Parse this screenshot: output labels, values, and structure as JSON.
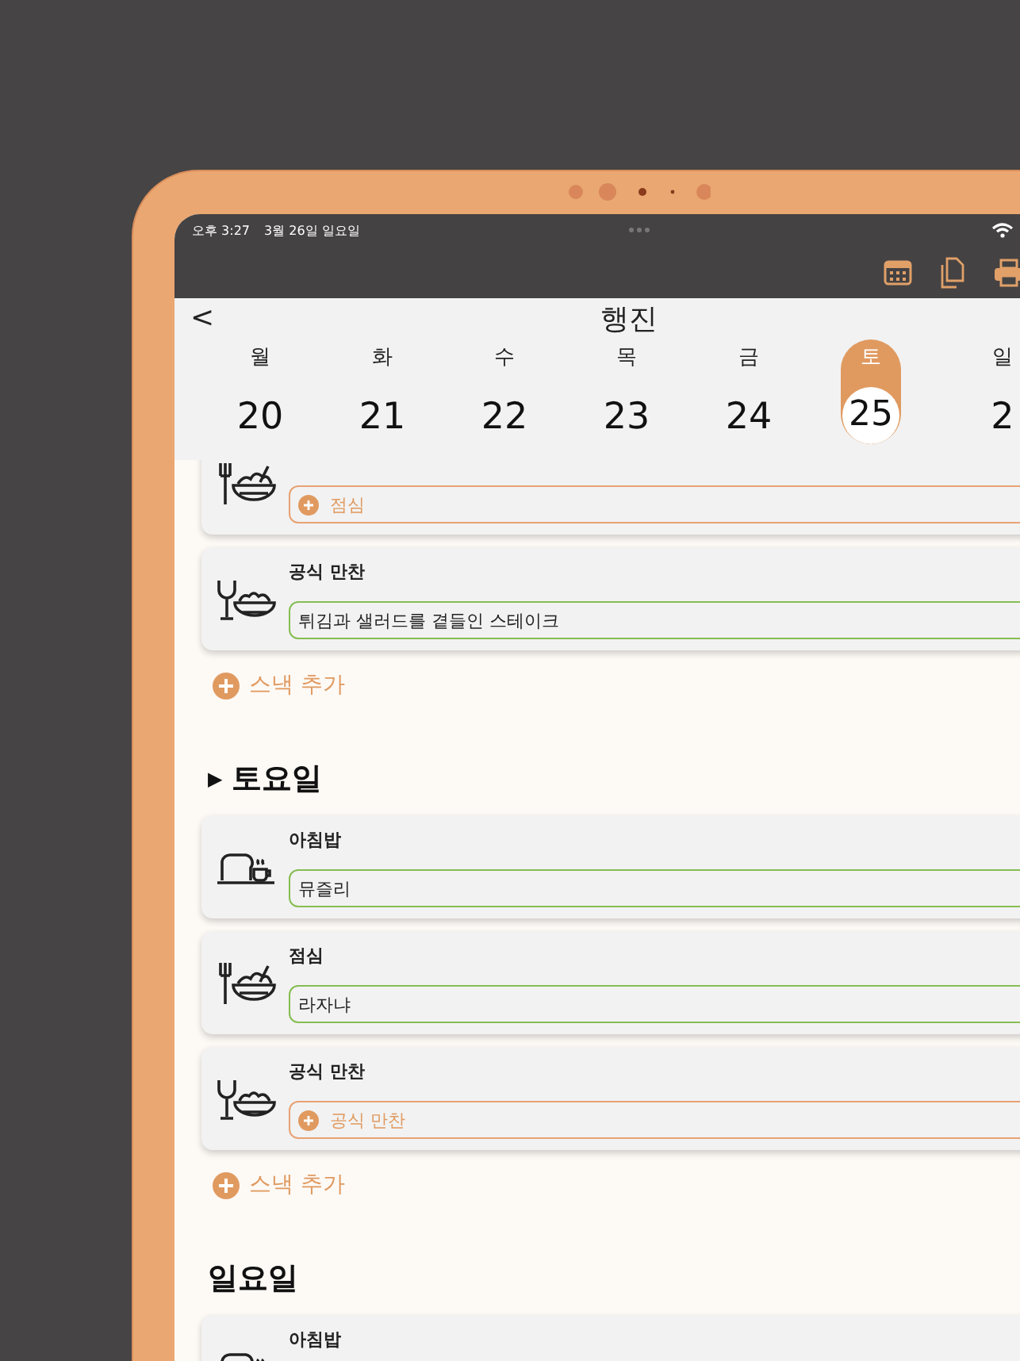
{
  "status_bar": {
    "time": "오후 3:27",
    "date": "3월 26일 일요일"
  },
  "header": {
    "back": "<",
    "title": "행진"
  },
  "week": [
    {
      "weekday": "월",
      "date": "20",
      "selected": false
    },
    {
      "weekday": "화",
      "date": "21",
      "selected": false
    },
    {
      "weekday": "수",
      "date": "22",
      "selected": false
    },
    {
      "weekday": "목",
      "date": "23",
      "selected": false
    },
    {
      "weekday": "금",
      "date": "24",
      "selected": false
    },
    {
      "weekday": "토",
      "date": "25",
      "selected": true
    },
    {
      "weekday": "일",
      "date": "2",
      "selected": false
    }
  ],
  "sections": [
    {
      "meals": [
        {
          "kind": "lunch",
          "placeholder": "점심"
        },
        {
          "kind": "dinner",
          "label": "공식 만찬",
          "value": "튀김과 샐러드를 곁들인 스테이크"
        }
      ],
      "add_snack": "스낵 추가"
    },
    {
      "marker": "▶",
      "title": "토요일",
      "meals": [
        {
          "kind": "breakfast",
          "label": "아침밥",
          "value": "뮤즐리"
        },
        {
          "kind": "lunch",
          "label": "점심",
          "value": "라자냐"
        },
        {
          "kind": "dinner",
          "label": "공식 만찬",
          "placeholder": "공식 만찬"
        }
      ],
      "add_snack": "스낵 추가"
    },
    {
      "title": "일요일",
      "meals": [
        {
          "kind": "breakfast",
          "label": "아침밥"
        }
      ]
    }
  ]
}
